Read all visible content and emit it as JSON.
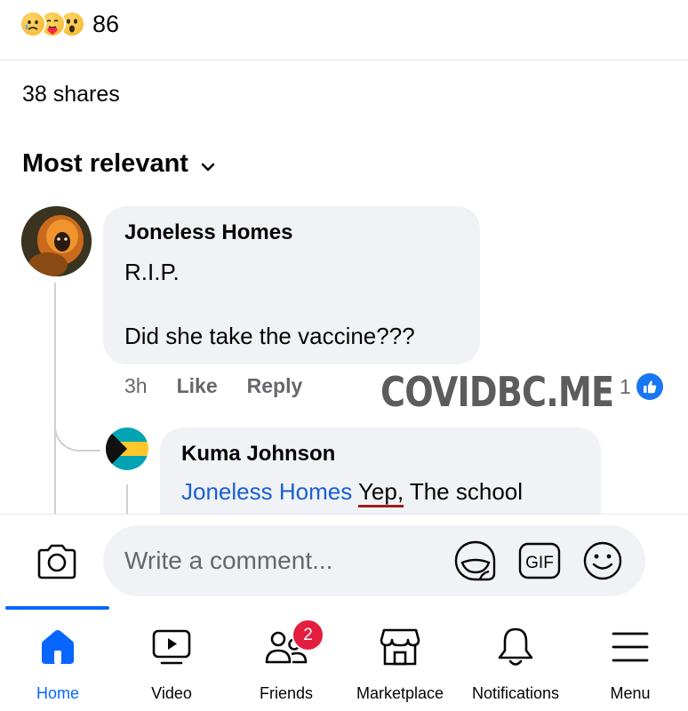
{
  "reactions": {
    "count": "86",
    "types": [
      "sad-emoji-icon",
      "care-emoji-icon",
      "wow-emoji-icon"
    ]
  },
  "shares": "38 shares",
  "sort": {
    "label": "Most relevant"
  },
  "comments": [
    {
      "author": "Joneless Homes",
      "lines": [
        "R.I.P.",
        "",
        "Did she take the vaccine???"
      ],
      "time": "3h",
      "like_label": "Like",
      "reply_label": "Reply",
      "reaction_count": "1",
      "reaction_icon": "like-icon"
    }
  ],
  "reply": {
    "author": "Kuma Johnson",
    "mention": "Joneless Homes",
    "text_underlined": "Yep,",
    "text_rest": " The school"
  },
  "watermark": "COVIDBC.ME",
  "composer": {
    "placeholder": "Write a comment...",
    "icons": [
      "camera-icon",
      "sticker-icon",
      "gif-icon",
      "emoji-icon"
    ],
    "gif_label": "GIF"
  },
  "tabs": [
    {
      "label": "Home",
      "icon": "home-icon",
      "active": true
    },
    {
      "label": "Video",
      "icon": "video-icon"
    },
    {
      "label": "Friends",
      "icon": "friends-icon",
      "badge": "2"
    },
    {
      "label": "Marketplace",
      "icon": "marketplace-icon"
    },
    {
      "label": "Notifications",
      "icon": "bell-icon"
    },
    {
      "label": "Menu",
      "icon": "menu-icon"
    }
  ],
  "colors": {
    "accent": "#0866ff",
    "bubble": "#f0f2f5",
    "badge": "#e41e3f",
    "like": "#1877f2",
    "mention": "#1a5fd4",
    "secondary_text": "#65676b"
  }
}
